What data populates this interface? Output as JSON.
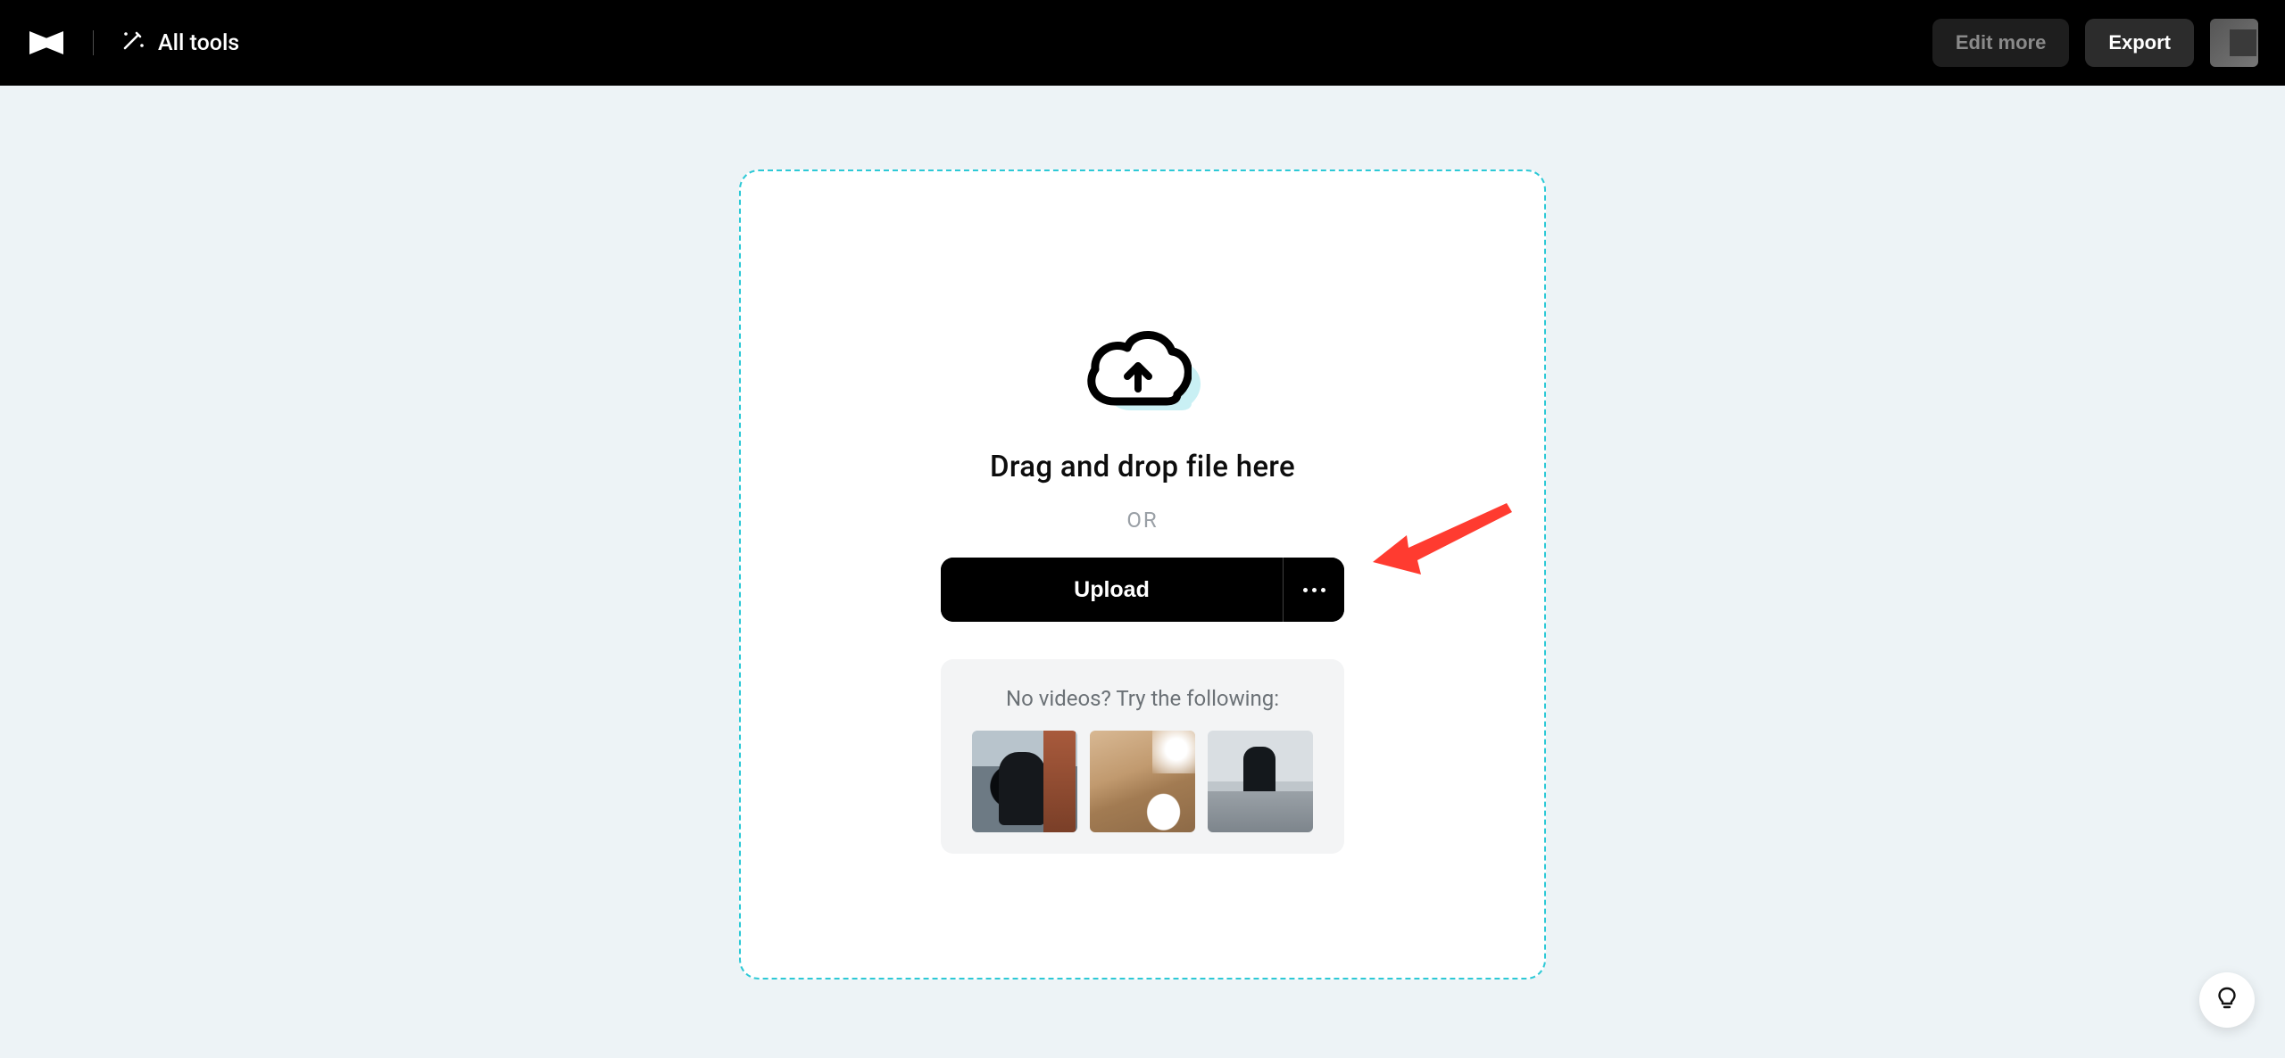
{
  "header": {
    "all_tools_label": "All tools",
    "edit_more_label": "Edit more",
    "export_label": "Export"
  },
  "dropzone": {
    "title": "Drag and drop file here",
    "or_label": "OR",
    "upload_label": "Upload",
    "samples_title": "No videos? Try the following:"
  },
  "annotation": {
    "arrow_color": "#ff3b30"
  }
}
